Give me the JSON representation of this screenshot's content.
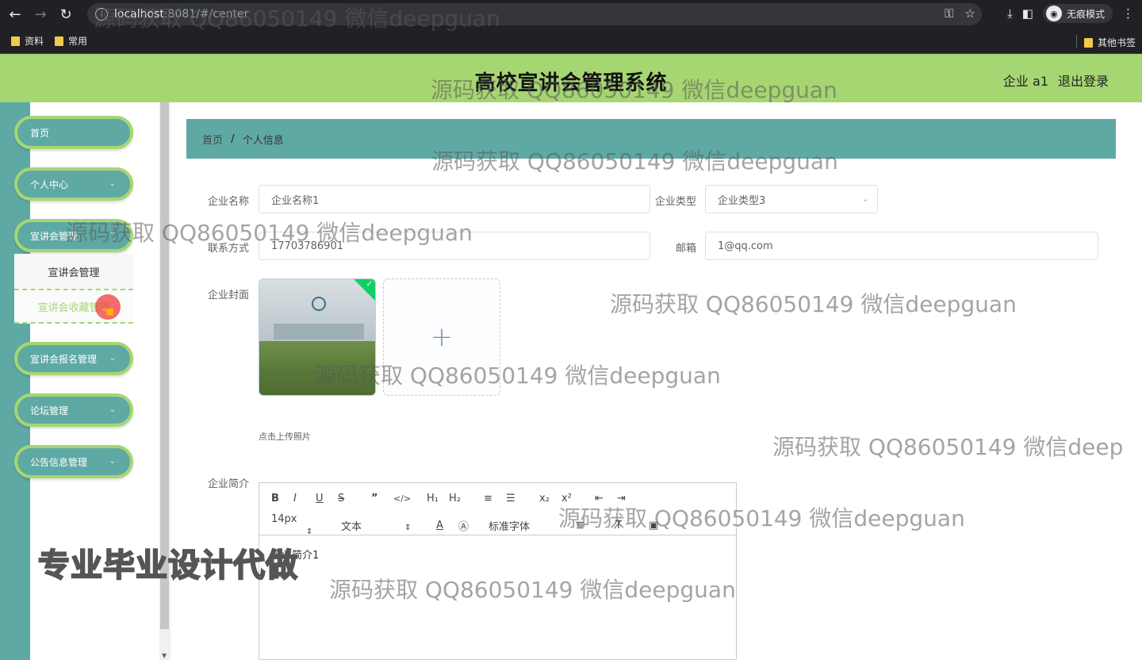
{
  "browser": {
    "url_host": "localhost",
    "url_path": ":8081/#/center",
    "incognito_label": "无痕模式",
    "bookmarks": [
      "资料",
      "常用"
    ],
    "other_bookmarks": "其他书签"
  },
  "header": {
    "title": "高校宣讲会管理系统",
    "user": "企业 a1",
    "logout": "退出登录"
  },
  "sidebar": {
    "items": [
      {
        "label": "首页"
      },
      {
        "label": "个人中心"
      },
      {
        "label": "宣讲会管理"
      },
      {
        "label": "宣讲会报名管理"
      },
      {
        "label": "论坛管理"
      },
      {
        "label": "公告信息管理"
      }
    ],
    "submenu": [
      "宣讲会管理",
      "宣讲会收藏管理"
    ]
  },
  "breadcrumb": {
    "home": "首页",
    "sep": "/",
    "current": "个人信息"
  },
  "form": {
    "company_name_label": "企业名称",
    "company_name_value": "企业名称1",
    "company_type_label": "企业类型",
    "company_type_value": "企业类型3",
    "contact_label": "联系方式",
    "contact_value": "17703786901",
    "email_label": "邮箱",
    "email_value": "1@qq.com",
    "cover_label": "企业封面",
    "upload_tip": "点击上传照片",
    "intro_label": "企业简介",
    "intro_value": "企业简介1",
    "editor": {
      "font_size": "14px",
      "paragraph": "文本",
      "font_family": "标准字体"
    }
  },
  "watermarks": {
    "text": "源码获取 QQ86050149 微信deepguan",
    "text_cut": "源码获取 QQ86050149 微信deep",
    "big": "专业毕业设计代做"
  }
}
